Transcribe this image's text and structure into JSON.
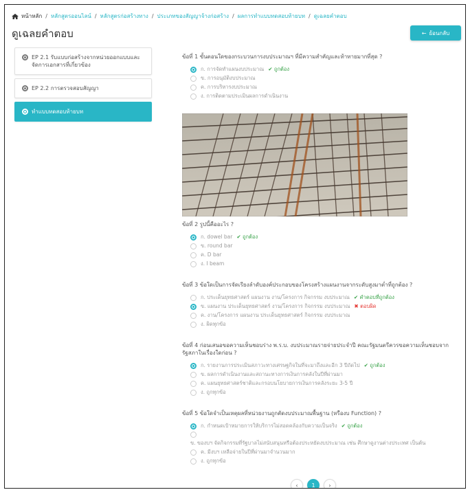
{
  "breadcrumb": {
    "home": "หน้าหลัก",
    "items": [
      "หลักสูตรออนไลน์",
      "หลักสูตรก่อสร้างทาง",
      "ประเภทของสัญญาจ้างก่อสร้าง",
      "ผลการทำแบบทดสอบท้ายบท",
      "ดูเฉลยคำตอบ"
    ]
  },
  "page_title": "ดูเฉลยคำตอบ",
  "back_button": "ย้อนกลับ",
  "sidebar": {
    "items": [
      {
        "label": "EP 2.1 รับแบบก่อสร้างจากหน่วยออกแบบและจัดการเอกสารที่เกี่ยวข้อง",
        "active": false
      },
      {
        "label": "EP 2.2 การตรวจสอบสัญญา",
        "active": false
      },
      {
        "label": "ทำแบบทดสอบท้ายบท",
        "active": true
      }
    ]
  },
  "questions": [
    {
      "title": "ข้อที่ 1 ขั้นตอนใดของกระบวนการงบประมาณฯ ที่มีความสำคัญและท้าทายมากที่สุด ?",
      "options": [
        {
          "text": "ก. การจัดทำแผนงบประมาณ",
          "checked": true,
          "mark": "✔ ถูกต้อง",
          "mark_type": "ok"
        },
        {
          "text": "ข. การอนุมัติงบประมาณ",
          "checked": false
        },
        {
          "text": "ค. การบริหารงบประมาณ",
          "checked": false
        },
        {
          "text": "ง. การติดตามประเมินผลการดำเนินงาน",
          "checked": false
        }
      ]
    },
    {
      "title": "ข้อที่ 2 รูปนี้คืออะไร ?",
      "options": [
        {
          "text": "ก. dowel bar",
          "checked": true,
          "mark": "✔ ถูกต้อง",
          "mark_type": "ok"
        },
        {
          "text": "ข. round bar",
          "checked": false
        },
        {
          "text": "ค. D bar",
          "checked": false
        },
        {
          "text": "ง. I beam",
          "checked": false
        }
      ]
    },
    {
      "title": "ข้อที่ 3 ข้อใดเป็นการจัดเรียงลำดับองค์ประกอบของโครงสร้างแผนงานจากระดับสูงมาต่ำที่ถูกต้อง ?",
      "options": [
        {
          "text": "ก. ประเด็นยุทธศาสตร์ แผนงาน งาน/โครงการ กิจกรรม งบประมาณ",
          "checked": false,
          "mark": "✔ คำตอบที่ถูกต้อง",
          "mark_type": "ok"
        },
        {
          "text": "ข. แผนงาน ประเด็นยุทธศาสตร์ งาน/โครงการ กิจกรรม งบประมาณ",
          "checked": true,
          "mark": "✖ ตอบผิด",
          "mark_type": "bad"
        },
        {
          "text": "ค. งาน/โครงการ แผนงาน ประเด็นยุทธศาสตร์ กิจกรรม งบประมาณ",
          "checked": false
        },
        {
          "text": "ง. ผิดทุกข้อ",
          "checked": false
        }
      ]
    },
    {
      "title": "ข้อที่ 4 ก่อนเสนอขอความเห็นชอบร่าง พ.ร.บ. งบประมาณรายจ่ายประจำปี คณะรัฐมนตรีควรขอความเห็นชอบจากรัฐสภาในเรื่องใดก่อน ?",
      "options": [
        {
          "text": "ก. รายงานการประเมินสภาวะทางเศรษฐกิจในที่จะมาถึงและอีก 3 ปีถัดไป",
          "checked": true,
          "mark": "✔ ถูกต้อง",
          "mark_type": "ok"
        },
        {
          "text": "ข. ผลการดำเนินงานและสถานะทางการเงินการคลังในปีที่ผ่านมา",
          "checked": false
        },
        {
          "text": "ค. แผนยุทธศาสตร์ชาติและกรอบนโยบายการเงินการคลังระยะ 3-5 ปี",
          "checked": false
        },
        {
          "text": "ง. ถูกทุกข้อ",
          "checked": false
        }
      ]
    },
    {
      "title": "ข้อที่ 5 ข้อใดจำเป็นเหตุผลที่หน่วยงานถูกตัดงบประมาณพื้นฐาน (หรืองบ Function) ?",
      "options": [
        {
          "text": "ก. กำหนดเป้าหมายการให้บริการไม่สอดคล้องกับความเป็นจริง",
          "checked": true,
          "mark": "✔ ถูกต้อง",
          "mark_type": "ok"
        },
        {
          "text": "ข. ของบฯ จัดกิจกรรมที่รัฐบาลไม่สนับสนุนหรือต้องประหยัดงบประมาณ เช่น ศึกษาดูงานต่างประเทศ เป็นต้น",
          "checked": false,
          "multiline": true
        },
        {
          "text": "ค. มีงบฯ เหลือจ่ายในปีที่ผ่านมาจำนวนมาก",
          "checked": false
        },
        {
          "text": "ง. ถูกทุกข้อ",
          "checked": false
        }
      ]
    }
  ],
  "pagination": {
    "prev": "‹",
    "current": "1",
    "next": "›"
  },
  "colors": {
    "accent": "#29b6c6",
    "ok": "#3aa34a",
    "bad": "#e53935"
  },
  "icons": {
    "home": "home-icon",
    "back": "arrow-left-icon",
    "radio": "radio-icon"
  }
}
